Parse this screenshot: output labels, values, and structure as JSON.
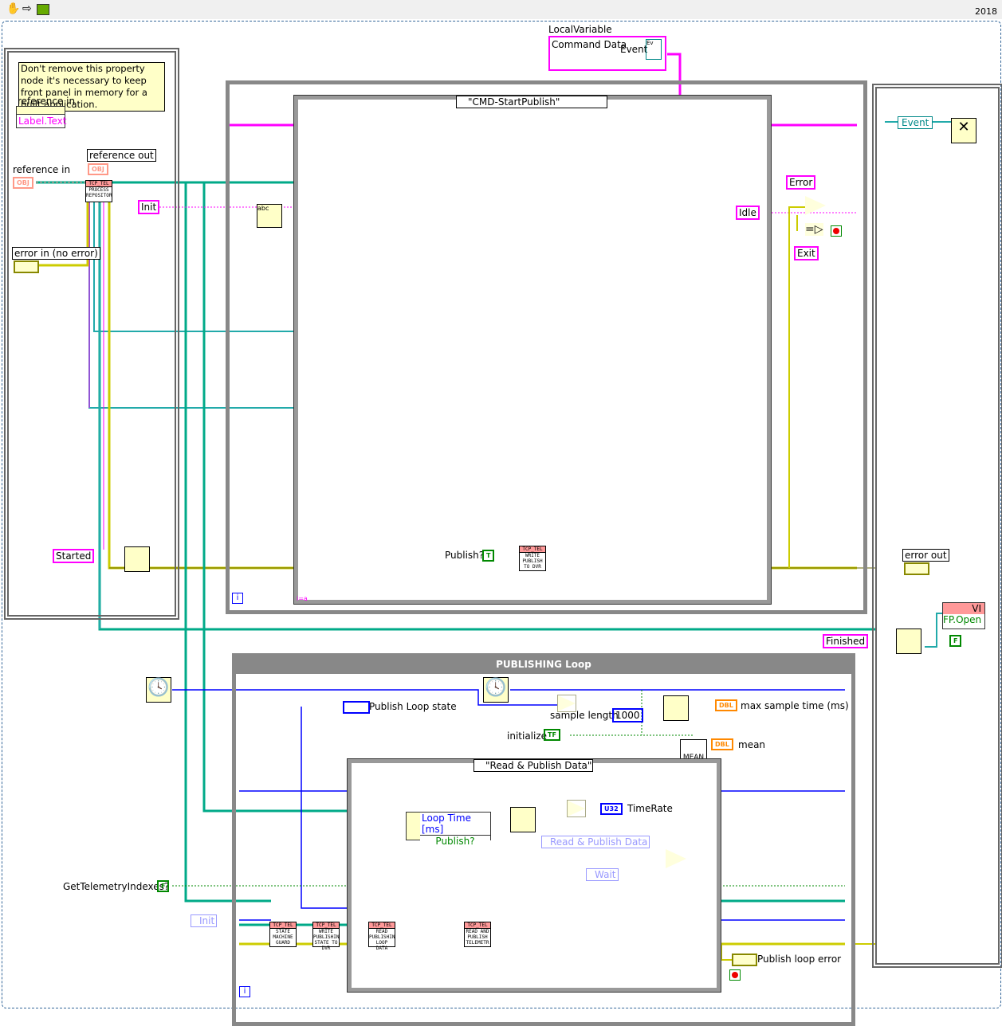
{
  "toolbar": {
    "icons": [
      "hand-icon",
      "arrow-icon",
      "run-icon"
    ],
    "version": "2018"
  },
  "local_variable": {
    "label": "LocalVariable",
    "items": [
      "Command Data",
      "Event"
    ]
  },
  "init_sequence": {
    "comment": "Don't remove this property node it's necessary to keep front panel in memory for a built application.",
    "property_ref_label": "reference in",
    "property": "Label.Text",
    "reference_in": "reference in",
    "reference_out": "reference out",
    "obj": "OBJ",
    "error_in": "error in (no error)",
    "init_const": "Init",
    "started_const": "Started",
    "subvi": {
      "head": "TCP_TEL",
      "body": "PROCESS REPOSITOR"
    }
  },
  "event_loop": {
    "case_selector": "\"CMD-StartPublish\"",
    "publish_label": "Publish?",
    "publish_const": "T",
    "subvi": {
      "head": "TCP_TEL",
      "body": "WRITE PUBLISH TO DVR"
    },
    "idle_const": "Idle",
    "error_const": "Error",
    "exit_const": "Exit",
    "iteration": "i",
    "case_index": "i=a"
  },
  "final_sequence": {
    "event_label": "Event",
    "error_out": "error out",
    "finished_const": "Finished",
    "vi_ref": "VI",
    "property": "FP.Open",
    "false_const": "F"
  },
  "publishing_loop": {
    "title": "PUBLISHING Loop",
    "state_label": "Publish Loop state",
    "sample_length_label": "sample length",
    "sample_length": "1000",
    "max_sample_label": "max sample time (ms)",
    "dbl": "DBL",
    "initialize_label": "initialize",
    "initialize_const": "TF",
    "mean_label": "mean",
    "mean_node": "MEAN",
    "case_selector": "\"Read & Publish Data\"",
    "bundle": [
      "Loop Time [ms]",
      "Publish?"
    ],
    "timerate_label": "TimeRate",
    "u32": "U32",
    "enum_read": "Read & Publish Data",
    "enum_wait": "Wait",
    "get_indexes_label": "GetTelemetryIndexes?",
    "get_indexes_const": "F",
    "init_enum": "Init",
    "error_label": "Publish loop error",
    "iteration": "i",
    "subvis": [
      {
        "head": "TCP_TEL",
        "body": "STATE MACHINE GUARD"
      },
      {
        "head": "TCP_TEL",
        "body": "WRITE PUBLISHIN STATE TO DVR"
      },
      {
        "head": "TCP_TEL",
        "body": "READ PUBLISHIN LOOP DATA"
      },
      {
        "head": "TCP_TEL",
        "body": "READ AND PUBLISH TELEMETR"
      }
    ]
  }
}
